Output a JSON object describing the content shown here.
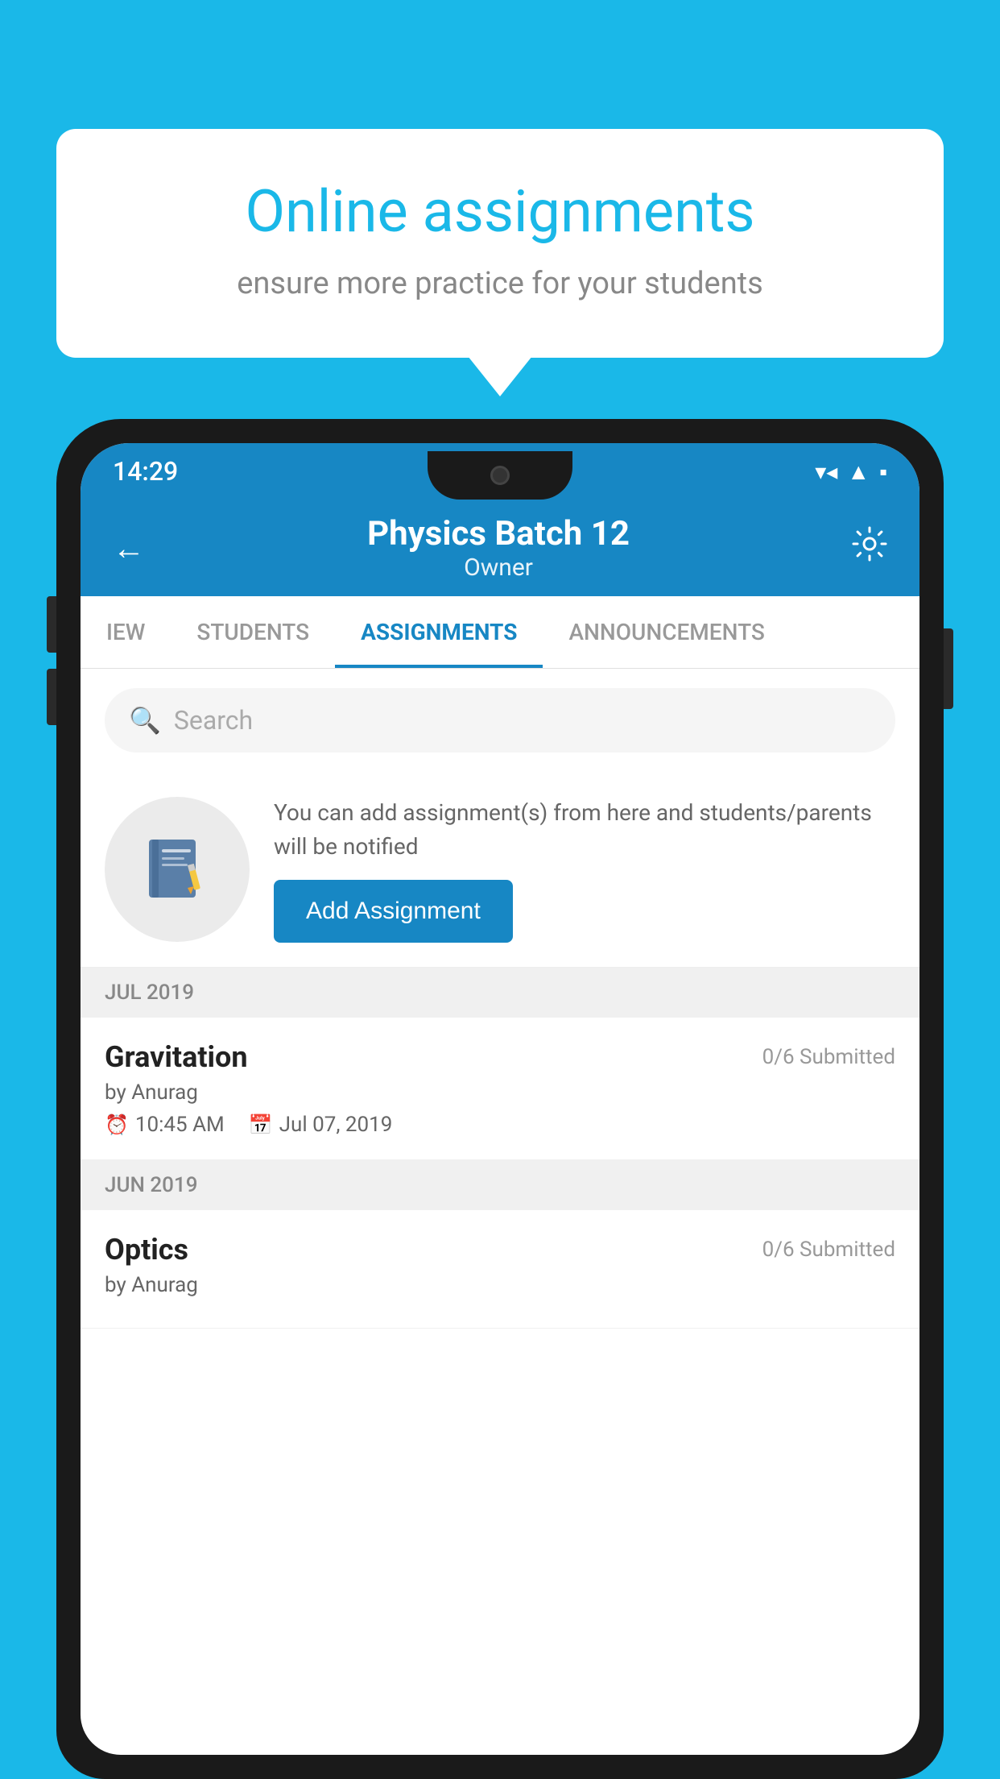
{
  "background_color": "#1ab8e8",
  "speech_bubble": {
    "title": "Online assignments",
    "subtitle": "ensure more practice for your students"
  },
  "phone": {
    "status_bar": {
      "time": "14:29",
      "wifi": "▼▲",
      "signal": "▲",
      "battery": "▪"
    },
    "header": {
      "title": "Physics Batch 12",
      "subtitle": "Owner",
      "back_label": "←",
      "settings_label": "⚙"
    },
    "tabs": [
      {
        "label": "IEW",
        "active": false
      },
      {
        "label": "STUDENTS",
        "active": false
      },
      {
        "label": "ASSIGNMENTS",
        "active": true
      },
      {
        "label": "ANNOUNCEMENTS",
        "active": false
      }
    ],
    "search": {
      "placeholder": "Search"
    },
    "promo": {
      "description": "You can add assignment(s) from here and students/parents will be notified",
      "add_button": "Add Assignment"
    },
    "sections": [
      {
        "month_label": "JUL 2019",
        "assignments": [
          {
            "title": "Gravitation",
            "submitted": "0/6 Submitted",
            "author": "by Anurag",
            "time": "10:45 AM",
            "date": "Jul 07, 2019"
          }
        ]
      },
      {
        "month_label": "JUN 2019",
        "assignments": [
          {
            "title": "Optics",
            "submitted": "0/6 Submitted",
            "author": "by Anurag",
            "time": "",
            "date": ""
          }
        ]
      }
    ]
  }
}
